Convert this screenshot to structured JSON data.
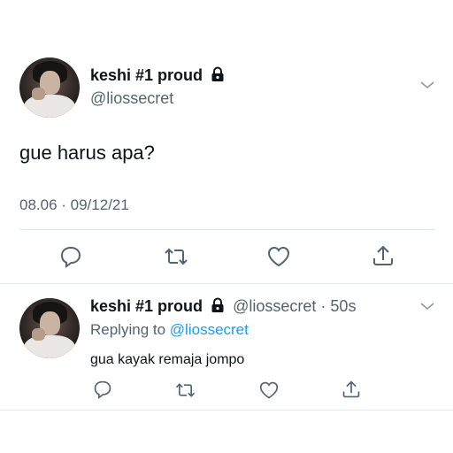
{
  "tweet": {
    "author_name": "keshi #1 proud",
    "author_handle": "@liossecret",
    "text": "gue harus apa?",
    "timestamp": "08.06 · 09/12/21",
    "actions": [
      "reply-icon",
      "retweet-icon",
      "like-icon",
      "share-icon"
    ]
  },
  "reply": {
    "author_name": "keshi #1 proud",
    "author_handle": "@liossecret",
    "time_sep": "·",
    "time": "50s",
    "replying_prefix": "Replying to",
    "replying_handle": "@liossecret",
    "text": "gua kayak remaja jompo",
    "actions": [
      "reply-icon",
      "retweet-icon",
      "like-icon",
      "share-icon"
    ]
  },
  "colors": {
    "text": "#0f1419",
    "muted": "#536471",
    "accent": "#1d9bf0",
    "divider": "#e1e8ed"
  }
}
